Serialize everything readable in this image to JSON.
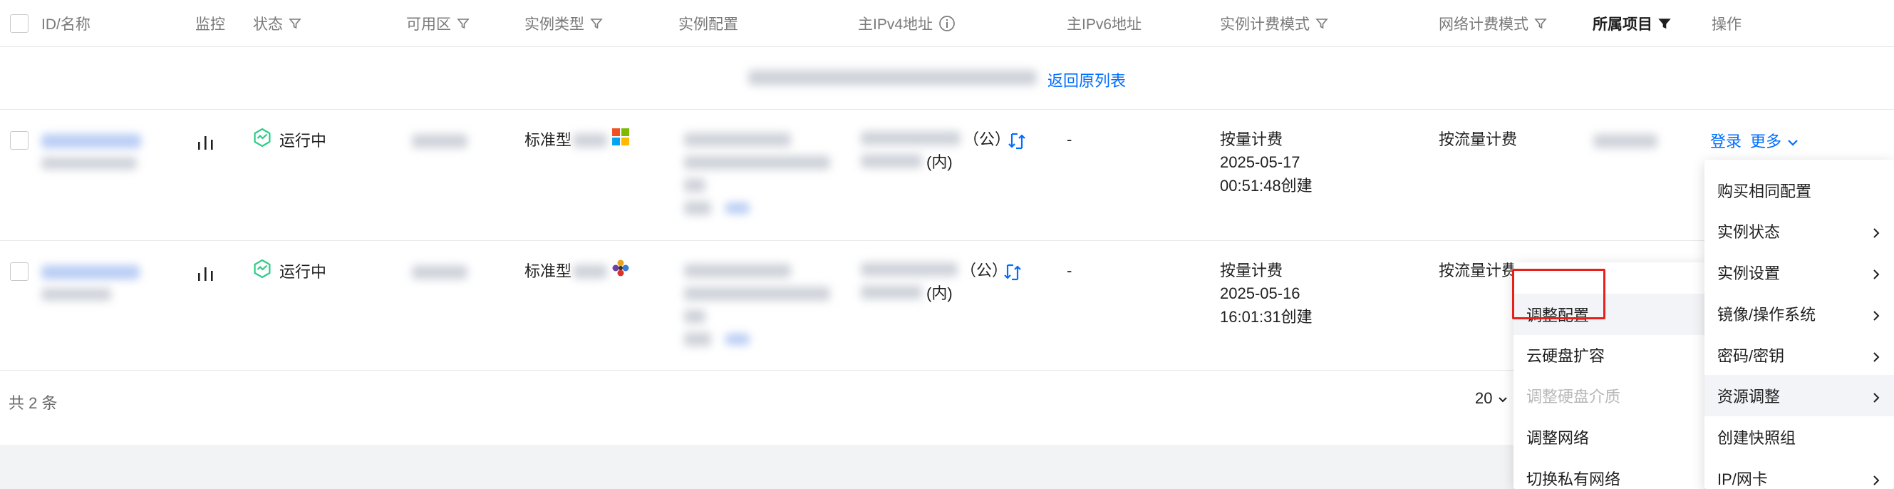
{
  "header": {
    "id_name": "ID/名称",
    "monitor": "监控",
    "status": "状态",
    "zone": "可用区",
    "instance_type": "实例类型",
    "instance_config": "实例配置",
    "ipv4": "主IPv4地址",
    "ipv6": "主IPv6地址",
    "billing_mode": "实例计费模式",
    "network_billing": "网络计费模式",
    "project": "所属项目",
    "actions": "操作"
  },
  "back_link": "返回原列表",
  "rows": [
    {
      "status": "运行中",
      "type_prefix": "标准型",
      "os_icon": "windows-icon",
      "ip_public_suffix": "（公）",
      "ip_private_suffix": "(内)",
      "ipv6": "-",
      "billing": "按量计费",
      "billing_date": "2025-05-17",
      "billing_time": "00:51:48创建",
      "network_billing": "按流量计费",
      "action_login": "登录",
      "action_more": "更多"
    },
    {
      "status": "运行中",
      "type_prefix": "标准型",
      "os_icon": "linux-distro-icon",
      "ip_public_suffix": "（公）",
      "ip_private_suffix": "(内)",
      "ipv6": "-",
      "billing": "按量计费",
      "billing_date": "2025-05-16",
      "billing_time": "16:01:31创建",
      "network_billing": "按流量计费"
    }
  ],
  "footer": {
    "total": "共 2 条",
    "page_size": "20"
  },
  "more_menu": {
    "items": [
      "购买相同配置",
      "实例状态",
      "实例设置",
      "镜像/操作系统",
      "密码/密钥",
      "资源调整",
      "创建快照组",
      "IP/网卡"
    ],
    "active": "资源调整"
  },
  "resource_submenu": {
    "items": [
      "调整配置",
      "云硬盘扩容",
      "调整硬盘介质",
      "调整网络",
      "切换私有网络"
    ],
    "disabled": "调整硬盘介质",
    "highlighted": "调整配置"
  },
  "colors": {
    "link": "#006eff",
    "running": "#29cc85",
    "highlight": "#e6211b"
  }
}
